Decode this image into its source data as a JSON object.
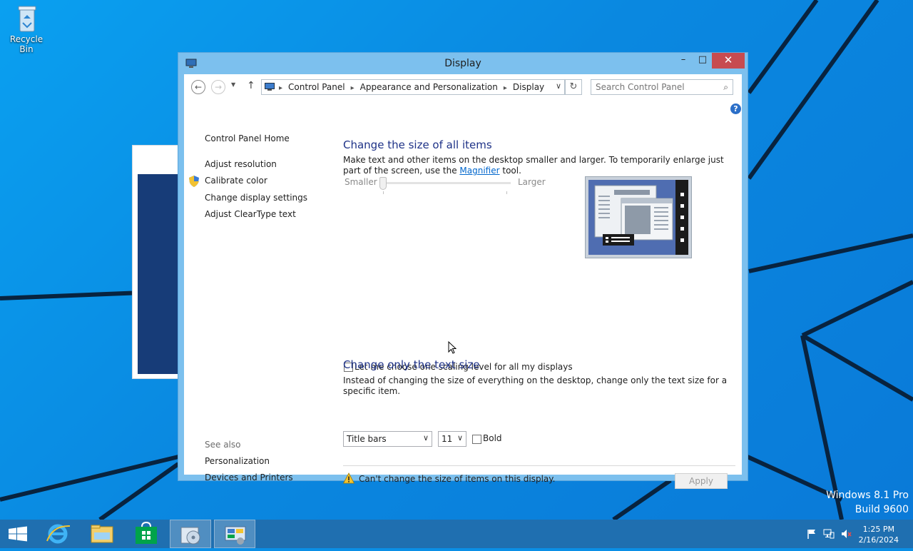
{
  "desktop": {
    "recycle_bin_label": "Recycle Bin",
    "watermark_line1": "Windows 8.1 Pro",
    "watermark_line2": "Build 9600"
  },
  "window": {
    "title": "Display",
    "minimize_glyph": "–",
    "maximize_glyph": "□",
    "close_glyph": "✕"
  },
  "nav": {
    "back_glyph": "←",
    "forward_glyph": "→",
    "recent_glyph": "▼",
    "up_glyph": "↑",
    "breadcrumb": [
      "Control Panel",
      "Appearance and Personalization",
      "Display"
    ],
    "breadcrumb_sep": "▸",
    "dropdown_glyph": "∨",
    "refresh_glyph": "↻",
    "search_placeholder": "Search Control Panel",
    "search_value": "",
    "search_glyph": "⌕"
  },
  "help_glyph": "?",
  "sidebar": {
    "home": "Control Panel Home",
    "links": [
      "Adjust resolution",
      "Calibrate color",
      "Change display settings",
      "Adjust ClearType text"
    ],
    "see_also_title": "See also",
    "see_also": [
      "Personalization",
      "Devices and Printers"
    ]
  },
  "main": {
    "size_heading": "Change the size of all items",
    "size_desc_before": "Make text and other items on the desktop smaller and larger. To temporarily enlarge just part of the screen, use the ",
    "size_desc_link": "Magnifier",
    "size_desc_after": " tool.",
    "slider_min_label": "Smaller",
    "slider_max_label": "Larger",
    "slider_level": 0,
    "scaling_checkbox_label": "Let me choose one scaling level for all my displays",
    "scaling_checked": false,
    "text_heading": "Change only the text size",
    "text_desc": "Instead of changing the size of everything on the desktop, change only the text size for a specific item.",
    "item_select_value": "Title bars",
    "size_select_value": "11",
    "select_arrow": "∨",
    "bold_label": "Bold",
    "bold_checked": false,
    "warning_text": "Can't change the size of items on this display.",
    "apply_label": "Apply"
  },
  "taskbar": {
    "time": "1:25 PM",
    "date": "2/16/2024",
    "icons": [
      "start-icon",
      "internet-explorer-icon",
      "file-explorer-icon",
      "store-icon",
      "setup-disc-icon",
      "control-panel-icon"
    ]
  },
  "colors": {
    "heading_blue": "#1e3287",
    "link_blue": "#0066cc",
    "close_red": "#c74b50",
    "taskbar": "#1f6fb0",
    "window_frame": "#7cc0ee"
  }
}
